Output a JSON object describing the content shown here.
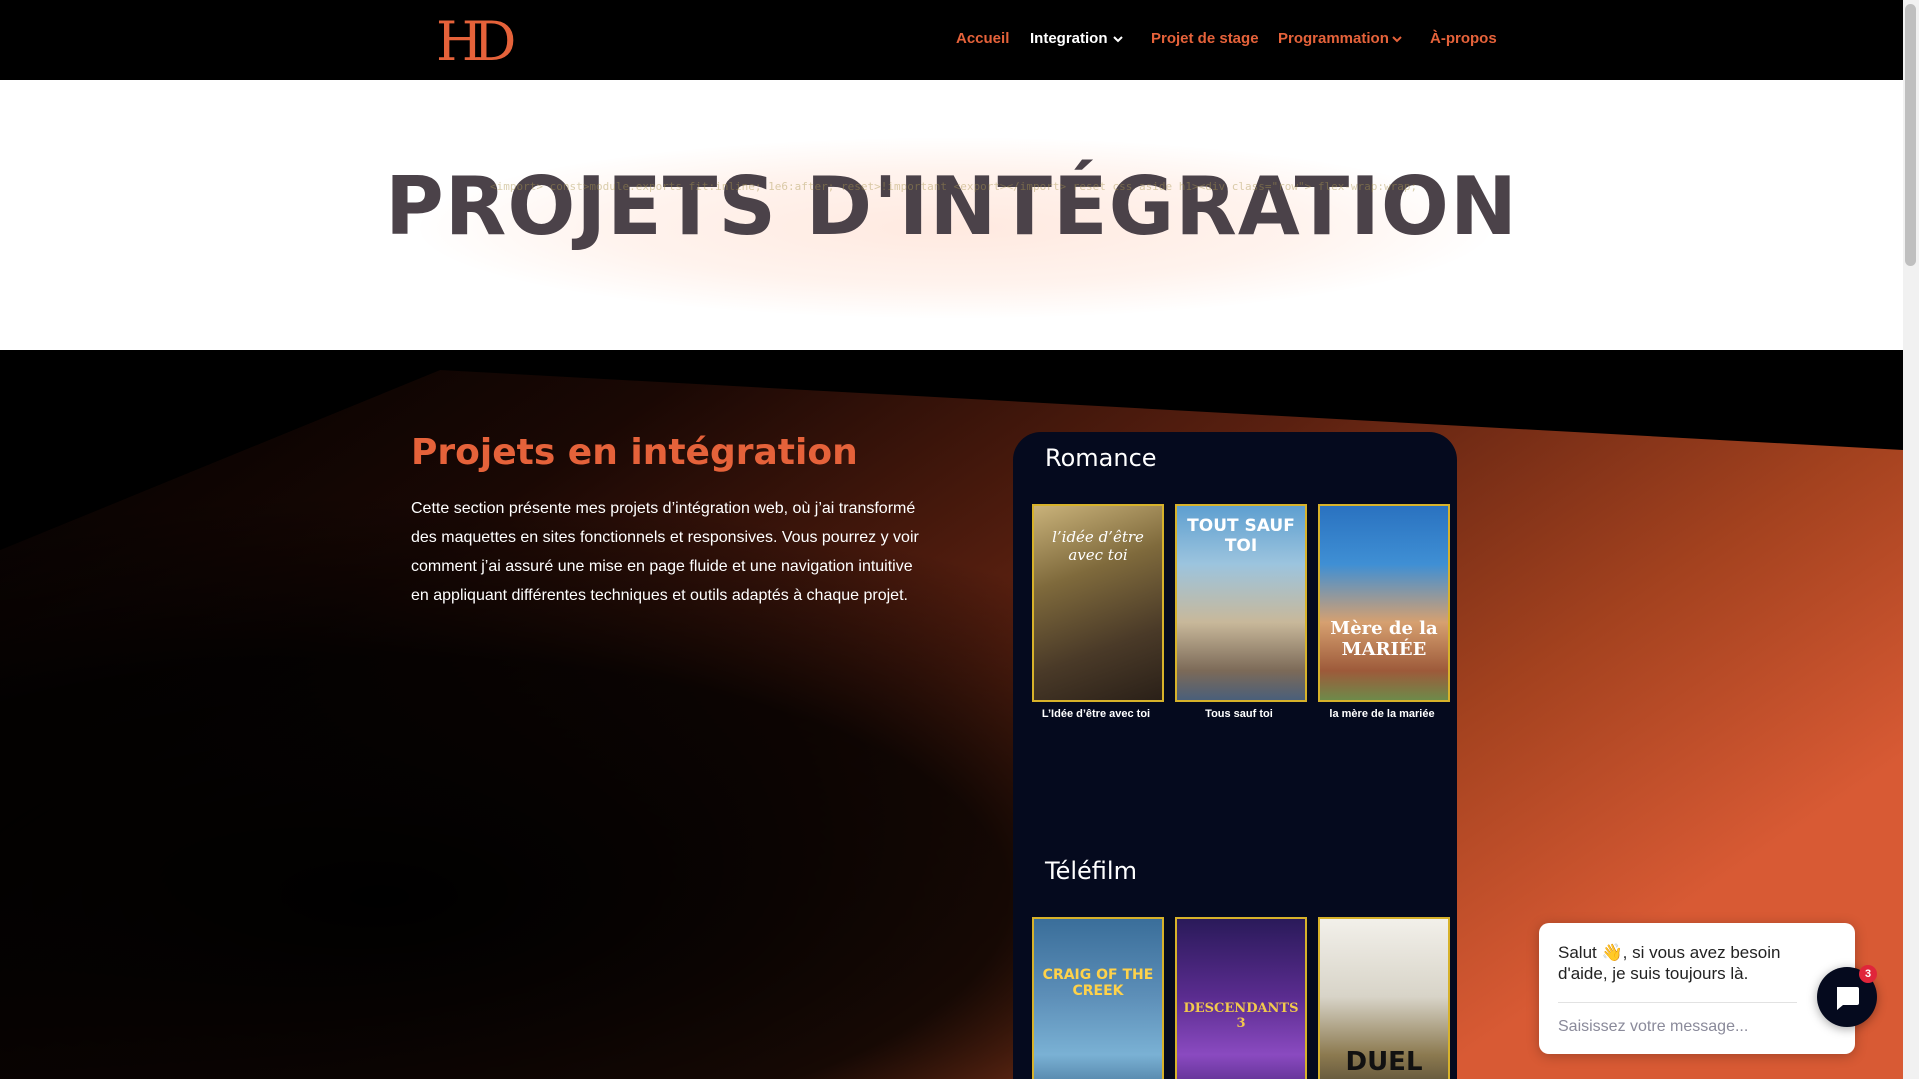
{
  "nav": {
    "logo_text": "HD",
    "items": [
      {
        "label": "Accueil"
      },
      {
        "label": "Integration"
      },
      {
        "label": "Projet de stage"
      },
      {
        "label": "Programmation"
      },
      {
        "label": "À-propos"
      }
    ]
  },
  "hero": {
    "title": "PROJETS D'INTÉGRATION"
  },
  "section": {
    "title": "Projets en intégration",
    "text": "Cette section présente mes projets d’intégration web, où j’ai transformé des maquettes en sites fonctionnels et responsives. Vous pourrez y voir comment j’ai assuré une mise en page fluide et une navigation intuitive en appliquant différentes techniques et outils adaptés à chaque projet."
  },
  "categories": [
    {
      "title": "Romance",
      "posters": [
        {
          "caption": "L’Idée d’être avec toi",
          "art_text": "l’idée d’être avec toi"
        },
        {
          "caption": "Tous sauf toi",
          "art_text": "TOUT SAUF TOI"
        },
        {
          "caption": "la mère de la mariée",
          "art_text": "Mère de la MARIÉE"
        }
      ]
    },
    {
      "title": "Téléfilm",
      "posters": [
        {
          "art_text": "CRAIG OF THE CREEK"
        },
        {
          "art_text": "DESCENDANTS 3"
        },
        {
          "art_text": "DUEL"
        }
      ]
    }
  ],
  "chat": {
    "message": "Salut 👋, si vous avez besoin d'aide, je suis toujours là.",
    "placeholder": "Saisissez votre message...",
    "badge": "3"
  },
  "colors": {
    "accent": "#e5623a",
    "header_bg": "#000000",
    "panel_bg": "#050a1e",
    "poster_border": "#d7b22a"
  }
}
